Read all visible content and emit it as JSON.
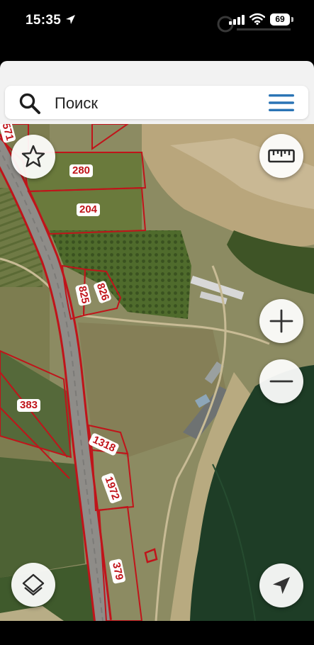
{
  "status_bar": {
    "time": "15:35",
    "battery": "69"
  },
  "search": {
    "placeholder": "Поиск"
  },
  "parcels": [
    "280",
    "204",
    "825",
    "826",
    "383",
    "1318",
    "1972",
    "379",
    "571"
  ],
  "colors": {
    "parcel_border": "#c0141a",
    "accent": "#2a74b5",
    "water": "#1e3d26"
  },
  "icons": {
    "search": "search-icon",
    "menu": "menu-icon",
    "favorite": "star-icon",
    "ruler": "ruler-icon",
    "zoom_in": "plus-icon",
    "zoom_out": "minus-icon",
    "layers": "layers-icon",
    "locate": "navigation-arrow-icon"
  }
}
